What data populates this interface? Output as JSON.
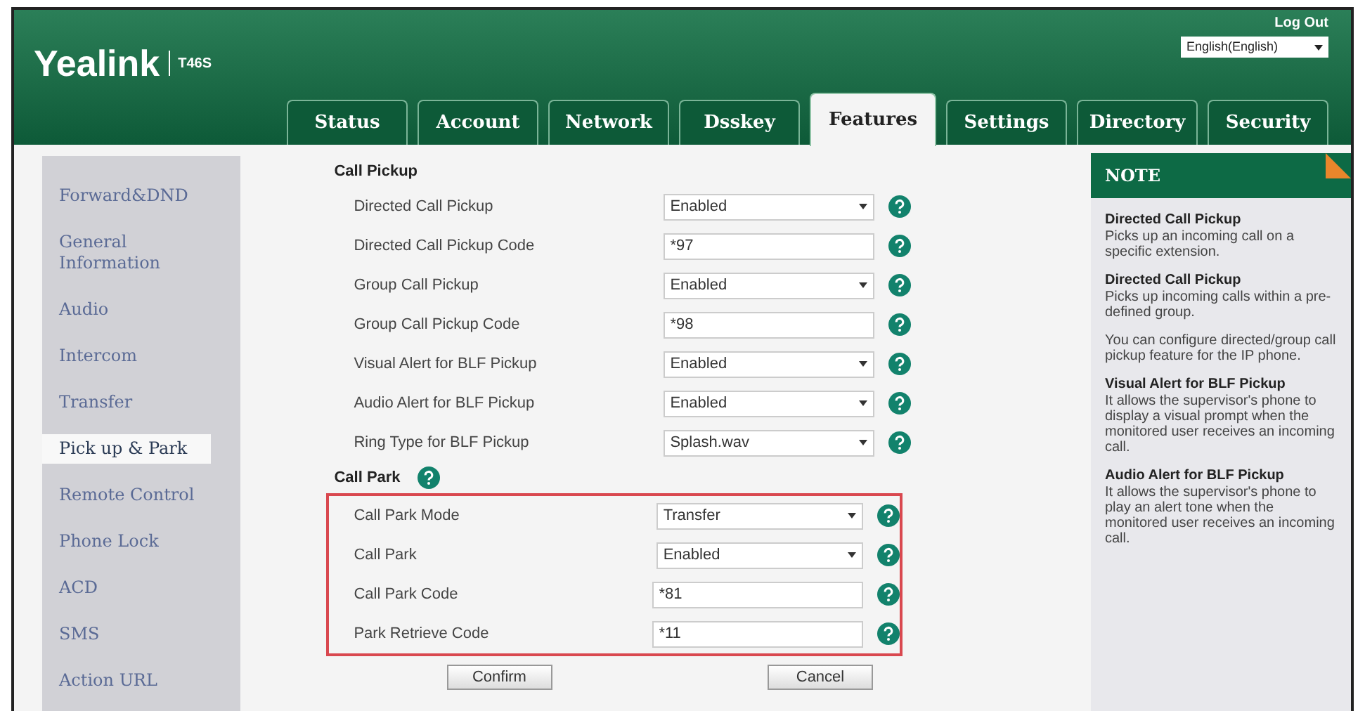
{
  "header": {
    "logo": "Yealink",
    "model": "T46S",
    "logout": "Log Out",
    "language": "English(English)"
  },
  "tabs": [
    {
      "label": "Status",
      "selected": false
    },
    {
      "label": "Account",
      "selected": false
    },
    {
      "label": "Network",
      "selected": false
    },
    {
      "label": "Dsskey",
      "selected": false
    },
    {
      "label": "Features",
      "selected": true
    },
    {
      "label": "Settings",
      "selected": false
    },
    {
      "label": "Directory",
      "selected": false
    },
    {
      "label": "Security",
      "selected": false
    }
  ],
  "sidebar": {
    "items": [
      {
        "label": "Forward&DND",
        "selected": false
      },
      {
        "label": "General Information",
        "selected": false
      },
      {
        "label": "Audio",
        "selected": false
      },
      {
        "label": "Intercom",
        "selected": false
      },
      {
        "label": "Transfer",
        "selected": false
      },
      {
        "label": "Pick up & Park",
        "selected": true
      },
      {
        "label": "Remote Control",
        "selected": false
      },
      {
        "label": "Phone Lock",
        "selected": false
      },
      {
        "label": "ACD",
        "selected": false
      },
      {
        "label": "SMS",
        "selected": false
      },
      {
        "label": "Action URL",
        "selected": false
      }
    ]
  },
  "sections": [
    {
      "title": "Call Pickup",
      "help": false,
      "outlined": false,
      "rows": [
        {
          "label": "Directed Call Pickup",
          "kind": "select",
          "value": "Enabled"
        },
        {
          "label": "Directed Call Pickup Code",
          "kind": "text",
          "value": "*97"
        },
        {
          "label": "Group Call Pickup",
          "kind": "select",
          "value": "Enabled"
        },
        {
          "label": "Group Call Pickup Code",
          "kind": "text",
          "value": "*98"
        },
        {
          "label": "Visual Alert for BLF Pickup",
          "kind": "select",
          "value": "Enabled"
        },
        {
          "label": "Audio Alert for BLF Pickup",
          "kind": "select",
          "value": "Enabled"
        },
        {
          "label": "Ring Type for BLF Pickup",
          "kind": "select",
          "value": "Splash.wav"
        }
      ]
    },
    {
      "title": "Call Park",
      "help": true,
      "outlined": true,
      "rows": [
        {
          "label": "Call Park Mode",
          "kind": "select",
          "value": "Transfer"
        },
        {
          "label": "Call Park",
          "kind": "select",
          "value": "Enabled"
        },
        {
          "label": "Call Park Code",
          "kind": "text",
          "value": "*81"
        },
        {
          "label": "Park Retrieve Code",
          "kind": "text",
          "value": "*11"
        }
      ]
    }
  ],
  "buttons": [
    "Confirm",
    "Cancel"
  ],
  "note": {
    "title": "NOTE",
    "entries": [
      {
        "title": "Directed Call Pickup",
        "body": "Picks up an incoming call on a specific extension."
      },
      {
        "title": "Directed Call Pickup",
        "body": "Picks up incoming calls within a pre-defined group."
      },
      {
        "body": "You can configure directed/group call pickup feature for the IP phone."
      },
      {
        "title": "Visual Alert for BLF Pickup",
        "body": "It allows the supervisor's phone to display a visual prompt when the monitored user receives an incoming call."
      },
      {
        "title": "Audio Alert for BLF Pickup",
        "body": "It allows the supervisor's phone to play an alert tone when the monitored user receives an incoming call."
      }
    ]
  }
}
